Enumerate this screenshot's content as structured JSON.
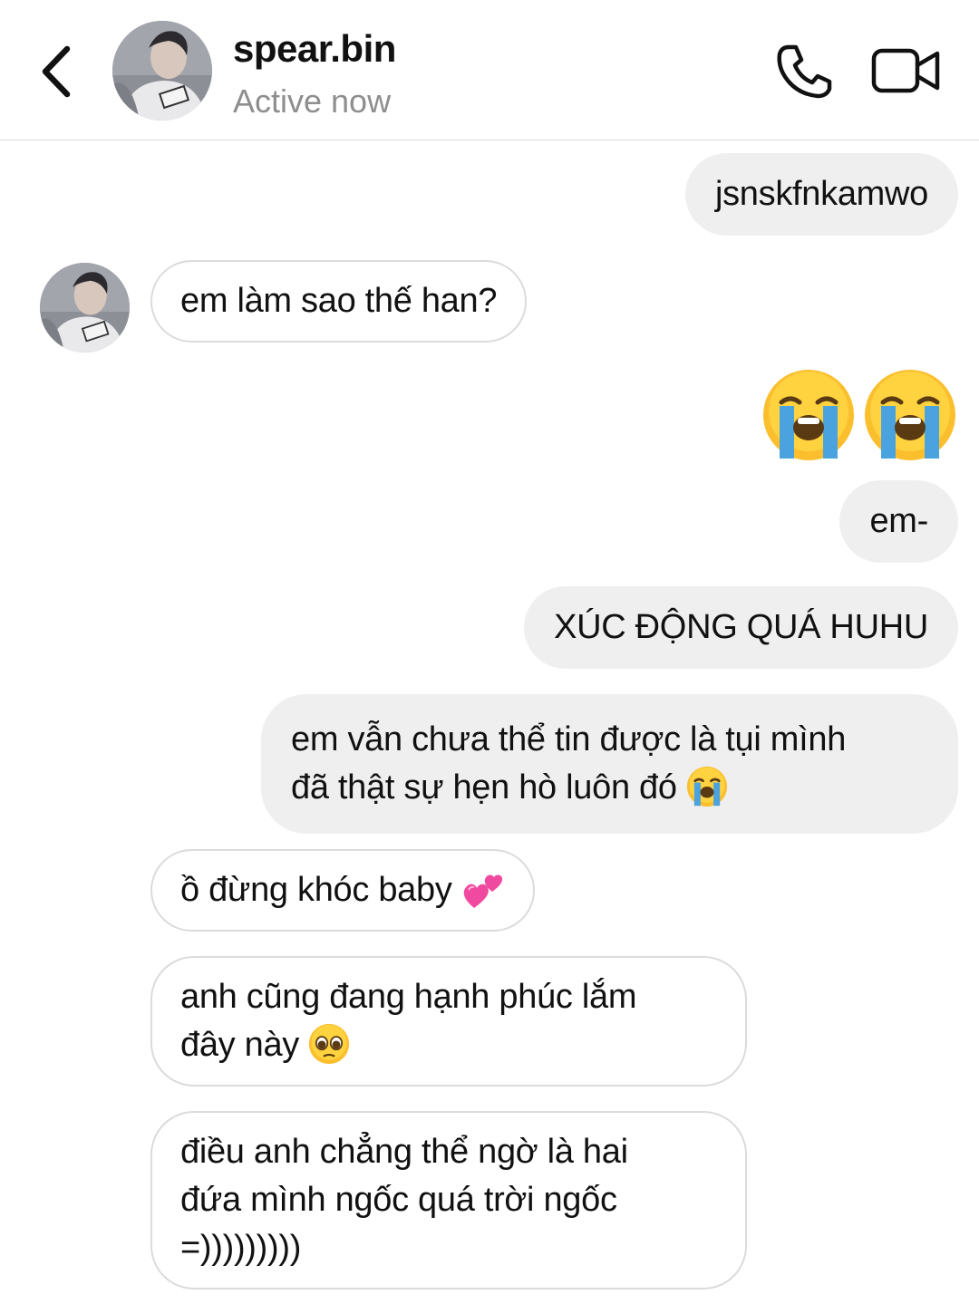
{
  "header": {
    "username": "spear.bin",
    "status": "Active now",
    "back_icon": "chevron-left-icon",
    "call_icon": "phone-icon",
    "video_icon": "video-camera-icon"
  },
  "colors": {
    "outgoing_bubble": "#efefef",
    "incoming_border": "#dbdbdb",
    "status_text": "#8e8e8e"
  },
  "messages": [
    {
      "side": "out",
      "text": "jsnskfnkamwo"
    },
    {
      "side": "in",
      "text": "em làm sao thế han?"
    },
    {
      "side": "out",
      "type": "emoji-only",
      "emojis": [
        "loudly-crying-face",
        "loudly-crying-face"
      ]
    },
    {
      "side": "out",
      "text": "em-"
    },
    {
      "side": "out",
      "text": "XÚC ĐỘNG QUÁ HUHU"
    },
    {
      "side": "out",
      "line1": "em vẫn chưa thể tin được là tụi mình",
      "line2": "đã thật sự hẹn hò luôn đó",
      "emoji": "loudly-crying-face"
    },
    {
      "side": "in",
      "text": "ồ đừng khóc baby",
      "emoji": "two-hearts"
    },
    {
      "side": "in",
      "line1": "anh cũng đang hạnh phúc lắm",
      "line2": "đây này",
      "emoji": "pleading-face"
    },
    {
      "side": "in",
      "line1": "điều anh chẳng thể ngờ là hai",
      "line2": "đứa mình ngốc quá trời ngốc",
      "line3": "=)))))))))"
    }
  ]
}
